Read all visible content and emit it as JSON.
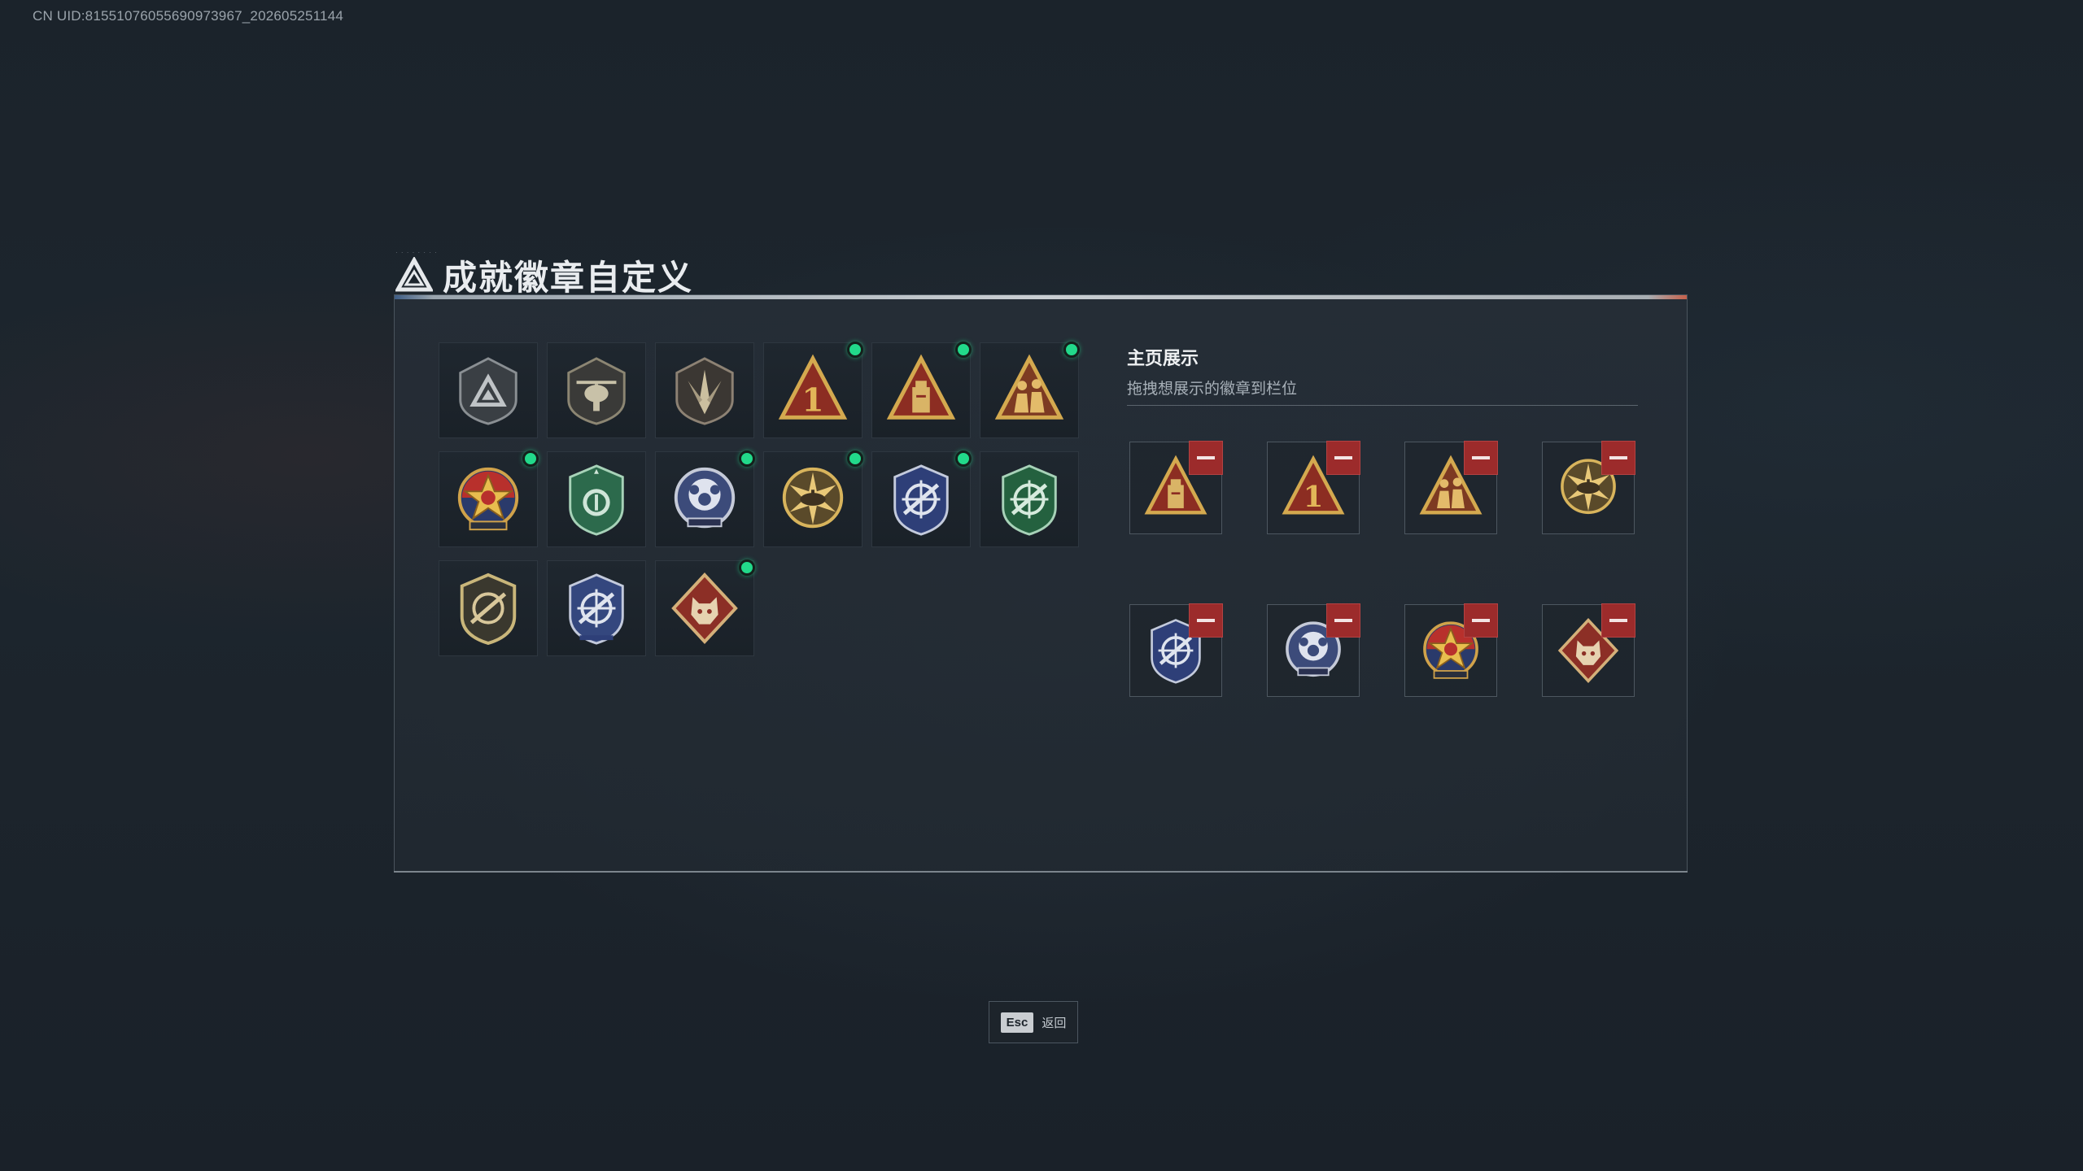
{
  "uid_text": "CN UID:81551076055690973967_202605251144",
  "title": "成就徽章自定义",
  "showcase": {
    "title": "主页展示",
    "subtitle": "拖拽想展示的徽章到栏位"
  },
  "esc": {
    "key": "Esc",
    "label": "返回"
  },
  "colors": {
    "new_dot": "#22d98a",
    "remove": "#9c2b2b",
    "panel_border": "#4a545d"
  },
  "badges": [
    {
      "name": "dark-shield-triangle-badge",
      "new": false
    },
    {
      "name": "dark-shield-helicopter-badge",
      "new": false
    },
    {
      "name": "dark-shield-blade-badge",
      "new": false
    },
    {
      "name": "red-triangle-number-one-badge",
      "new": true
    },
    {
      "name": "red-triangle-tower-badge",
      "new": true
    },
    {
      "name": "red-triangle-soldiers-badge",
      "new": true
    },
    {
      "name": "star-medal-badge",
      "new": true
    },
    {
      "name": "green-shield-badge",
      "new": false
    },
    {
      "name": "blue-paws-badge",
      "new": true
    },
    {
      "name": "gold-sunburst-tank-badge",
      "new": true
    },
    {
      "name": "blue-crosshair-rifle-badge",
      "new": true
    },
    {
      "name": "green-crosshair-shield-badge",
      "new": false
    },
    {
      "name": "gold-shield-rifle-badge",
      "new": false
    },
    {
      "name": "blue-crosshair-rifle-badge-alt",
      "new": false
    },
    {
      "name": "red-diamond-wolf-badge",
      "new": true
    }
  ],
  "showcase_slots": [
    "red-triangle-tower-badge",
    "red-triangle-number-one-badge",
    "red-triangle-soldiers-badge",
    "gold-sunburst-tank-badge",
    "blue-crosshair-rifle-badge",
    "blue-paws-badge",
    "star-medal-badge",
    "red-diamond-wolf-badge"
  ]
}
